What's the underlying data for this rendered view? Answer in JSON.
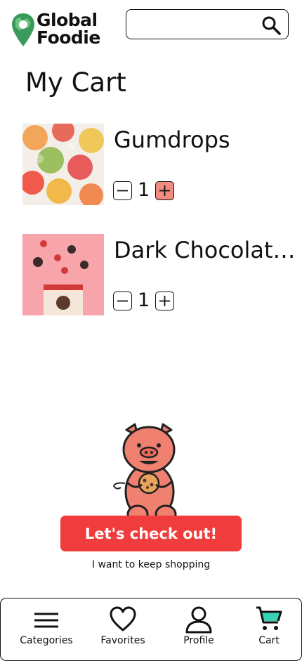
{
  "header": {
    "logo_line1": "Global",
    "logo_line2": "Foodie",
    "search_value": ""
  },
  "page_title": "My Cart",
  "cart": {
    "items": [
      {
        "name": "Gumdrops",
        "quantity": "1"
      },
      {
        "name": "Dark Chocolate...",
        "quantity": "1"
      }
    ]
  },
  "checkout_label": "Let's check out!",
  "keep_shopping_label": "I want to keep shopping",
  "nav": {
    "items": [
      {
        "label": "Categories",
        "icon": "menu-icon"
      },
      {
        "label": "Favorites",
        "icon": "heart-icon"
      },
      {
        "label": "Profile",
        "icon": "user-icon"
      },
      {
        "label": "Cart",
        "icon": "cart-icon"
      }
    ]
  },
  "colors": {
    "checkout": "#f03c3c",
    "qty_active": "#f28b7f",
    "mascot": "#f08070",
    "logo_green": "#3a9a5b"
  }
}
